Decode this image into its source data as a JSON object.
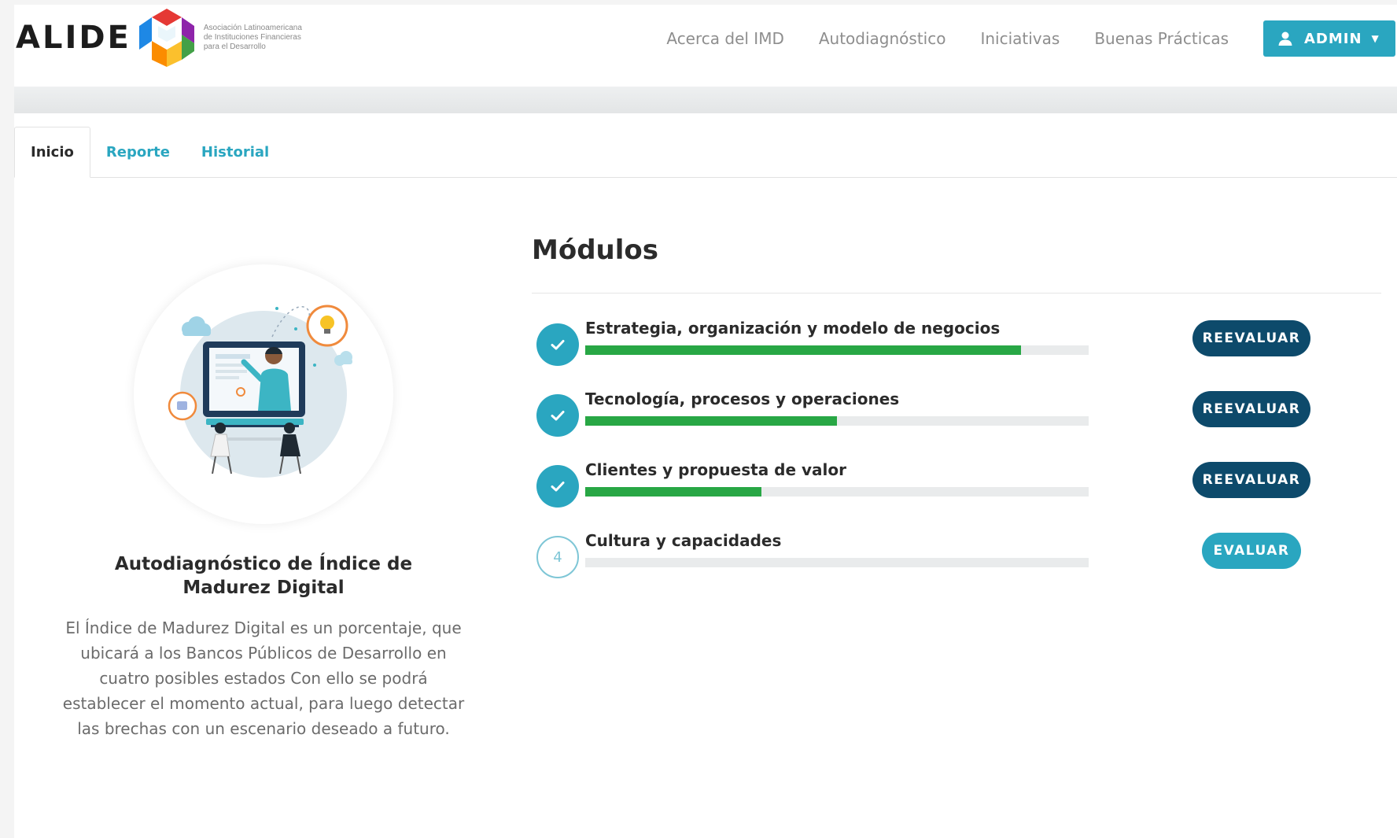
{
  "header": {
    "logo_word": "ALIDE",
    "logo_subtitle": [
      "Asociación Latinoamericana",
      "de Instituciones Financieras",
      "para el Desarrollo"
    ],
    "nav_links": [
      "Acerca del IMD",
      "Autodiagnóstico",
      "Iniciativas",
      "Buenas Prácticas"
    ],
    "user_menu_label": "ADMIN",
    "user_icon": "user-icon",
    "caret_icon": "caret-down-icon",
    "accent_color": "#2aa6c0"
  },
  "tabs": [
    {
      "label": "Inicio",
      "active": true
    },
    {
      "label": "Reporte",
      "active": false
    },
    {
      "label": "Historial",
      "active": false
    }
  ],
  "intro": {
    "title": "Autodiagnóstico de Índice de Madurez Digital",
    "description": "El Índice de Madurez Digital es un porcentaje, que ubicará a los Bancos Públicos de Desarrollo en cuatro posibles estados Con ello se podrá establecer el momento actual, para luego detectar las brechas con un escenario deseado a futuro.",
    "illustration": "online-meeting-illustration"
  },
  "modules": {
    "title": "Módulos",
    "items": [
      {
        "name": "Estrategia, organización y modelo de negocios",
        "status": "completed",
        "progress": 0.865,
        "action": "REEVALUAR"
      },
      {
        "name": "Tecnología, procesos y operaciones",
        "status": "completed",
        "progress": 0.5,
        "action": "REEVALUAR"
      },
      {
        "name": "Clientes y propuesta de valor",
        "status": "completed",
        "progress": 0.35,
        "action": "REEVALUAR"
      },
      {
        "name": "Cultura y capacidades",
        "status": "pending",
        "step": "4",
        "progress": 0,
        "action": "EVALUAR"
      }
    ],
    "colors": {
      "progress": "#28a745",
      "reevaluar": "#0d4a6b",
      "evaluar": "#2aa6c0"
    }
  }
}
